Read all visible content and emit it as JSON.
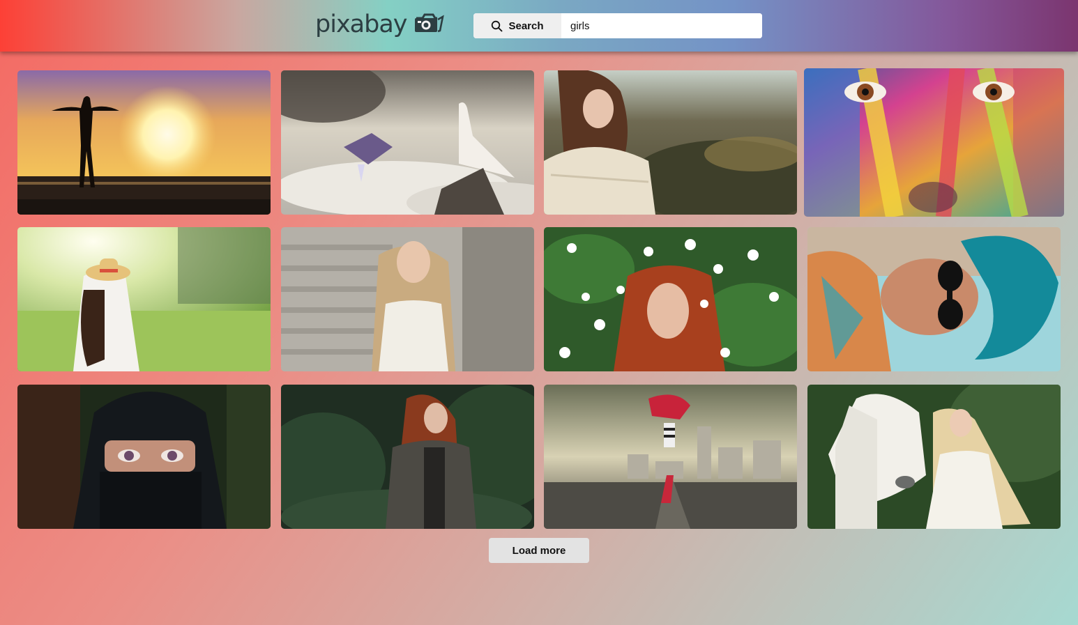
{
  "header": {
    "logo_text": "pixabay",
    "logo_icon": "camera-icon",
    "search_button_label": "Search",
    "search_icon": "search-icon",
    "search_value": "girls"
  },
  "gallery": {
    "images": [
      {
        "subject": "silhouette-sunset"
      },
      {
        "subject": "fantasy-clouds-castle"
      },
      {
        "subject": "girl-shawl-forest"
      },
      {
        "subject": "painted-face"
      },
      {
        "subject": "girl-hat-meadow"
      },
      {
        "subject": "girl-stone-stairs"
      },
      {
        "subject": "redhead-jasmine"
      },
      {
        "subject": "blue-hair-sunglasses"
      },
      {
        "subject": "hijab-eyes"
      },
      {
        "subject": "redhead-pine-forest"
      },
      {
        "subject": "dancer-city-road"
      },
      {
        "subject": "girl-white-horse"
      }
    ]
  },
  "load_more_label": "Load more",
  "colors": {
    "header_gradient_start": "#fd4036",
    "header_gradient_mid": "#84d0c4",
    "header_gradient_end": "#7b356f",
    "button_bg": "#e3e3e3"
  }
}
